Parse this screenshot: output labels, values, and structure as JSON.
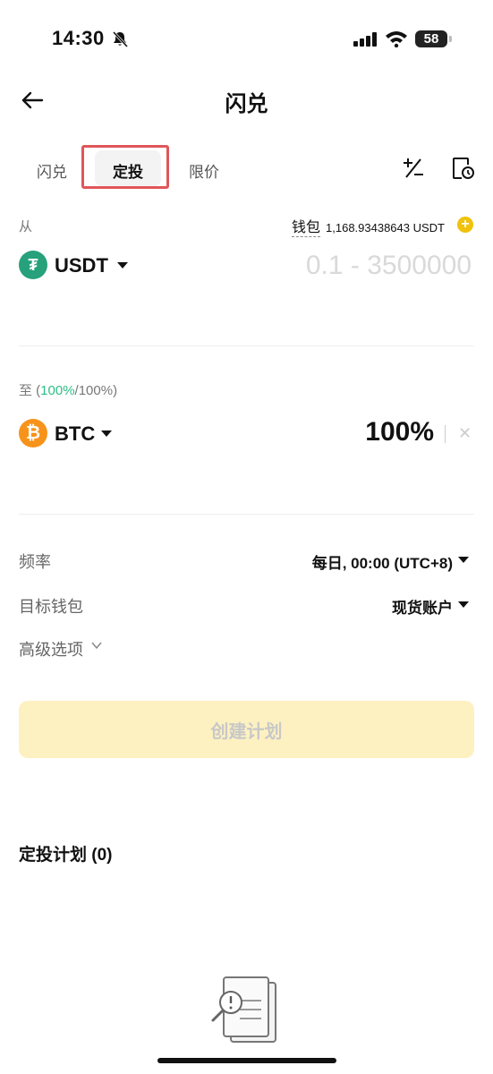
{
  "status_bar": {
    "time": "14:30",
    "battery": "58"
  },
  "header": {
    "title": "闪兑"
  },
  "tabs": [
    {
      "label": "闪兑"
    },
    {
      "label": "定投"
    },
    {
      "label": "限价"
    }
  ],
  "from": {
    "label": "从",
    "wallet_label": "钱包",
    "wallet_balance": "1,168.93438643 USDT",
    "coin": "USDT",
    "amount_placeholder": "0.1 - 3500000"
  },
  "to": {
    "label_prefix": "至 (",
    "label_highlight": "100%",
    "label_suffix": "/100%)",
    "coin": "BTC",
    "percent": "100%"
  },
  "settings": {
    "frequency_label": "频率",
    "frequency_value": "每日, 00:00 (UTC+8)",
    "target_wallet_label": "目标钱包",
    "target_wallet_value": "现货账户",
    "advanced_label": "高级选项"
  },
  "create_button": "创建计划",
  "plans": {
    "title": "定投计划 (0)"
  },
  "colors": {
    "accent": "#f0c20c",
    "green": "#2ebd85",
    "highlight": "#e0565a",
    "button_disabled": "#fdf1c1"
  }
}
